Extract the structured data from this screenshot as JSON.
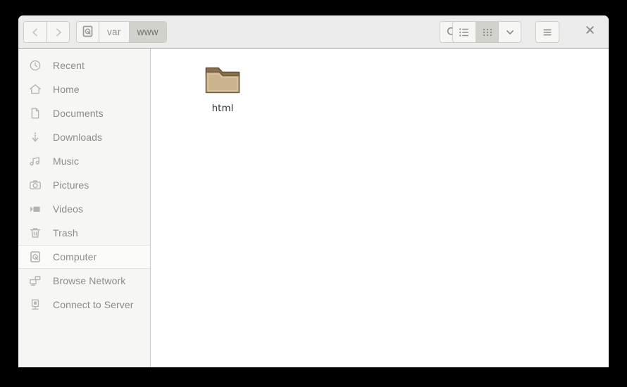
{
  "window": {
    "titlebar_bg": "#ececec",
    "content_bg": "#ffffff",
    "sidebar_bg": "#f6f6f5"
  },
  "toolbar": {
    "back_label": "Back",
    "forward_label": "Forward",
    "back_icon": "chevron-left-icon",
    "forward_icon": "chevron-right-icon",
    "breadcrumbs": [
      {
        "label": "",
        "icon": "drive-icon",
        "active": false
      },
      {
        "label": "var",
        "icon": "",
        "active": false
      },
      {
        "label": "www",
        "icon": "",
        "active": true
      }
    ],
    "search_label": "Search",
    "search_icon": "search-icon",
    "view_list_label": "List View",
    "view_list_icon": "list-view-icon",
    "view_grid_label": "Grid View",
    "view_grid_icon": "grid-view-icon",
    "view_dropdown_label": "View Options",
    "view_dropdown_icon": "chevron-down-icon",
    "menu_label": "Menu",
    "menu_icon": "hamburger-menu-icon",
    "close_label": "Close",
    "close_icon": "close-icon",
    "active_view": "grid",
    "active_bg": "#d2d2cd"
  },
  "sidebar": {
    "items": [
      {
        "label": "Recent",
        "icon": "clock-icon",
        "selected": false
      },
      {
        "label": "Home",
        "icon": "home-icon",
        "selected": false
      },
      {
        "label": "Documents",
        "icon": "document-icon",
        "selected": false
      },
      {
        "label": "Downloads",
        "icon": "download-icon",
        "selected": false
      },
      {
        "label": "Music",
        "icon": "music-icon",
        "selected": false
      },
      {
        "label": "Pictures",
        "icon": "camera-icon",
        "selected": false
      },
      {
        "label": "Videos",
        "icon": "video-icon",
        "selected": false
      },
      {
        "label": "Trash",
        "icon": "trash-icon",
        "selected": false
      },
      {
        "label": "Computer",
        "icon": "drive-icon",
        "selected": true
      },
      {
        "label": "Browse Network",
        "icon": "network-icon",
        "selected": false
      },
      {
        "label": "Connect to Server",
        "icon": "server-icon",
        "selected": false
      }
    ]
  },
  "content": {
    "files": [
      {
        "name": "html",
        "type": "folder",
        "icon": "folder-icon"
      }
    ],
    "folder_color_body": "#c8b189",
    "folder_color_tab": "#8a7049",
    "folder_color_edge": "#6f5b3e"
  }
}
